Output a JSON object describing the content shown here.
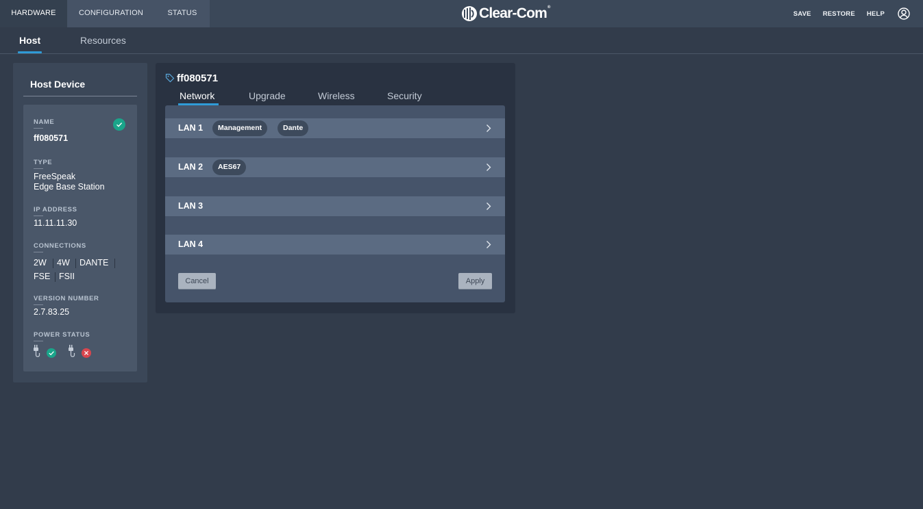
{
  "topnav": {
    "items": [
      {
        "label": "HARDWARE",
        "active": true
      },
      {
        "label": "CONFIGURATION",
        "active": false
      },
      {
        "label": "STATUS",
        "active": false
      }
    ]
  },
  "brand": {
    "logo_text": "Clear-Com",
    "registered": "®"
  },
  "actions": {
    "save": "SAVE",
    "restore": "RESTORE",
    "help": "HELP",
    "user_icon": "user-circle-icon"
  },
  "subtabs": [
    {
      "label": "Host",
      "active": true
    },
    {
      "label": "Resources",
      "active": false
    }
  ],
  "host_device": {
    "title": "Host Device",
    "name_label": "NAME",
    "name": "ff080571",
    "name_status": "ok",
    "type_label": "TYPE",
    "type_line1": "FreeSpeak",
    "type_line2": "Edge Base Station",
    "ip_label": "IP ADDRESS",
    "ip": "11.11.11.30",
    "connections_label": "CONNECTIONS",
    "connections": [
      "2W",
      "4W",
      "DANTE",
      "FSE",
      "FSII"
    ],
    "version_label": "VERSION NUMBER",
    "version": "2.7.83.25",
    "power_label": "POWER STATUS",
    "power": [
      {
        "icon": "power-plug-icon",
        "status": "ok"
      },
      {
        "icon": "power-plug-icon",
        "status": "error"
      }
    ]
  },
  "device": {
    "title": "ff080571",
    "tag_icon": "tag-icon",
    "tabs": [
      {
        "label": "Network",
        "active": true
      },
      {
        "label": "Upgrade",
        "active": false
      },
      {
        "label": "Wireless",
        "active": false
      },
      {
        "label": "Security",
        "active": false
      }
    ],
    "lans": [
      {
        "label": "LAN 1",
        "chips": [
          "Management",
          "Dante"
        ]
      },
      {
        "label": "LAN 2",
        "chips": [
          "AES67"
        ]
      },
      {
        "label": "LAN 3",
        "chips": []
      },
      {
        "label": "LAN 4",
        "chips": []
      }
    ],
    "cancel_label": "Cancel",
    "apply_label": "Apply"
  },
  "colors": {
    "accent": "#2f9bd7",
    "ok": "#1aa58a",
    "error": "#d9464e",
    "background": "#323c4b"
  }
}
